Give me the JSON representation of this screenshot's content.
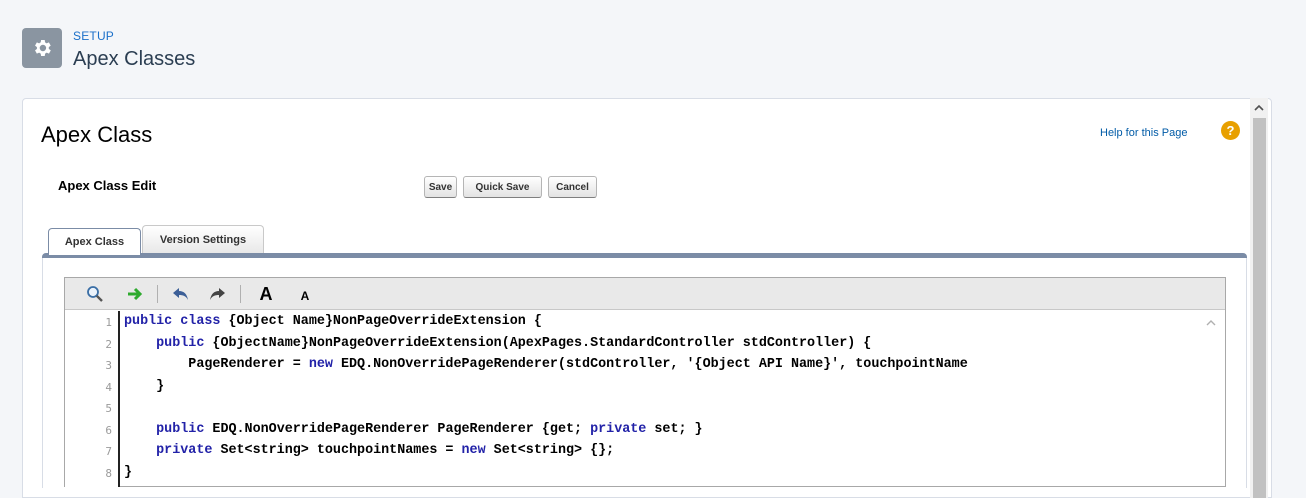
{
  "header": {
    "setup_label": "SETUP",
    "title": "Apex Classes",
    "icon": "gear-icon"
  },
  "page": {
    "heading": "Apex Class",
    "help_link": "Help for this Page",
    "help_icon": "question-icon"
  },
  "edit": {
    "section_label": "Apex Class Edit",
    "save": "Save",
    "quick_save": "Quick Save",
    "cancel": "Cancel"
  },
  "tabs": [
    {
      "label": "Apex Class",
      "active": true
    },
    {
      "label": "Version Settings",
      "active": false
    }
  ],
  "toolbar": {
    "search_icon": "search-icon",
    "goto_icon": "arrow-right-icon",
    "undo_icon": "undo-icon",
    "redo_icon": "redo-icon",
    "font_bigger": "A",
    "font_smaller": "A"
  },
  "code": {
    "line_numbers": [
      "1",
      "2",
      "3",
      "4",
      "5",
      "6",
      "7",
      "8"
    ],
    "lines": [
      [
        {
          "t": "public class ",
          "k": true
        },
        {
          "t": "{Object Name}NonPageOverrideExtension {",
          "k": false
        }
      ],
      [
        {
          "t": "    public ",
          "k": true
        },
        {
          "t": "{ObjectName}NonPageOverrideExtension(ApexPages.StandardController stdController) {",
          "k": false
        }
      ],
      [
        {
          "t": "        PageRenderer = ",
          "k": false
        },
        {
          "t": "new",
          "k": true
        },
        {
          "t": " EDQ.NonOverridePageRenderer(stdController, '{Object API Name}', touchpointName",
          "k": false
        }
      ],
      [
        {
          "t": "    }",
          "k": false
        }
      ],
      [
        {
          "t": "",
          "k": false
        }
      ],
      [
        {
          "t": "    public ",
          "k": true
        },
        {
          "t": "EDQ.NonOverridePageRenderer PageRenderer {get; ",
          "k": false
        },
        {
          "t": "private",
          "k": true
        },
        {
          "t": " set; }",
          "k": false
        }
      ],
      [
        {
          "t": "    private ",
          "k": true
        },
        {
          "t": "Set<string> touchpointNames = ",
          "k": false
        },
        {
          "t": "new",
          "k": true
        },
        {
          "t": " Set<string> {};",
          "k": false
        }
      ],
      [
        {
          "t": "}",
          "k": false
        }
      ]
    ]
  },
  "colors": {
    "link": "#015ba7",
    "keyword": "#2222a8",
    "tab_bar": "#7b8ca6",
    "help_icon": "#e8a000"
  }
}
